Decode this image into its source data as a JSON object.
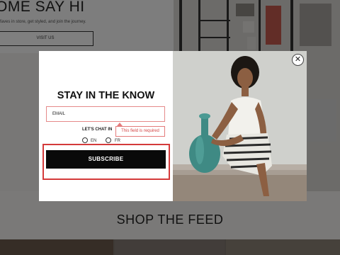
{
  "hero": {
    "title": "OME SAY HI",
    "subtitle": "faves in store, get styled, and join the journey.",
    "visit_label": "VISIT US"
  },
  "feed": {
    "title": "SHOP THE FEED"
  },
  "modal": {
    "title": "STAY IN THE KNOW",
    "email_placeholder": "EMAIL",
    "chat_label": "LET'S CHAT IN",
    "error_text": "This field is required",
    "language_options": [
      "EN",
      "FR"
    ],
    "subscribe_label": "SUBSCRIBE",
    "close_icon": "close-icon",
    "image": "woman-seated-with-green-vase"
  },
  "colors": {
    "error": "#d24444",
    "highlight": "#d43a3a",
    "button": "#0a0a0a"
  }
}
